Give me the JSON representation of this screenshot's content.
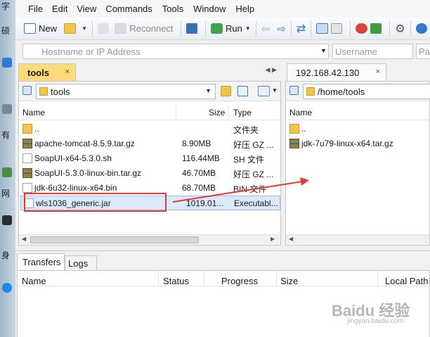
{
  "desktop": {
    "glyphs": [
      "字",
      "硕",
      "有",
      "网",
      "身"
    ]
  },
  "menu": [
    "File",
    "Edit",
    "View",
    "Commands",
    "Tools",
    "Window",
    "Help"
  ],
  "toolbar": {
    "new": "New",
    "reconnect": "Reconnect",
    "run": "Run"
  },
  "connection": {
    "hostname_placeholder": "Hostname or IP Address",
    "username_placeholder": "Username",
    "password_placeholder": "Pa"
  },
  "left_panel": {
    "tab_label": "tools",
    "tab_close": "×",
    "path": "tools",
    "columns": [
      "Name",
      "Size",
      "Type"
    ],
    "files": [
      {
        "name": "..",
        "size": "",
        "type": "文件夹",
        "icon": "folder"
      },
      {
        "name": "apache-tomcat-8.5.9.tar.gz",
        "size": "8.90MB",
        "type": "好压 GZ ...",
        "icon": "archive"
      },
      {
        "name": "SoapUI-x64-5.3.0.sh",
        "size": "116.44MB",
        "type": "SH 文件",
        "icon": "document"
      },
      {
        "name": "SoapUI-5.3.0-linux-bin.tar.gz",
        "size": "46.70MB",
        "type": "好压 GZ ...",
        "icon": "archive"
      },
      {
        "name": "jdk-6u32-linux-x64.bin",
        "size": "68.70MB",
        "type": "BIN 文件",
        "icon": "document"
      },
      {
        "name": "wls1036_generic.jar",
        "size": "1019.01...",
        "type": "Executabl...",
        "icon": "jar"
      }
    ]
  },
  "right_panel": {
    "tab_label": "192.168.42.130",
    "tab_close": "×",
    "path": "/home/tools",
    "columns": [
      "Name"
    ],
    "files": [
      {
        "name": "..",
        "icon": "folder"
      },
      {
        "name": "jdk-7u79-linux-x64.tar.gz",
        "icon": "archive"
      }
    ]
  },
  "bottom": {
    "tabs": [
      "Transfers",
      "Logs"
    ],
    "columns": [
      "Name",
      "Status",
      "Progress",
      "Size",
      "Local Path"
    ]
  },
  "watermark": {
    "brand": "Baidu 经验",
    "url": "jingyan.baidu.com"
  },
  "colors": {
    "active_tab": "#ffd97a",
    "annotation": "#e53935",
    "selection": "#dbe9fb"
  }
}
